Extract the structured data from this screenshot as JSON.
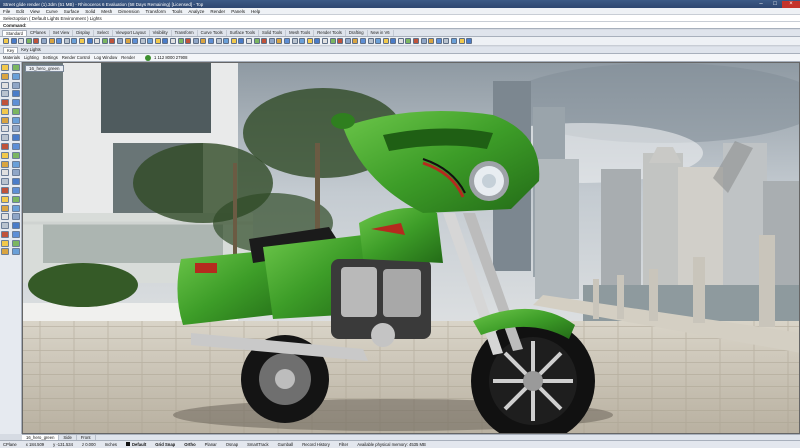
{
  "window": {
    "title": "Street glide render (1).3dm (51 MB) - Rhinoceros 6 Evaluation (58 Days Remaining) [Licensed] - Top"
  },
  "menu": [
    "File",
    "Edit",
    "View",
    "Curve",
    "Surface",
    "Solid",
    "Mesh",
    "Dimension",
    "Transform",
    "Tools",
    "Analyze",
    "Render",
    "Panels",
    "Help"
  ],
  "history_line": "Selectoption ( Default Lights Environment ) Lights",
  "command_prompt": "Command:",
  "toolbar_tabs": [
    "Standard",
    "CPlanes",
    "Set View",
    "Display",
    "Select",
    "Viewport Layout",
    "Visibility",
    "Transform",
    "Curve Tools",
    "Surface Tools",
    "Solid Tools",
    "Mesh Tools",
    "Render Tools",
    "Drafting",
    "New in V6"
  ],
  "panel_tabs": [
    "Key",
    "Key Lights"
  ],
  "render_toolbar": {
    "items": [
      "Materials",
      "Lighting",
      "Settings",
      "Render Control",
      "Log Window",
      "Render"
    ],
    "memory": "1 112 8000 27908"
  },
  "viewport": {
    "label": "16_hero_green"
  },
  "viewport_tabs": [
    "16_hero_green",
    "Side",
    "Front"
  ],
  "status": {
    "cplane": "CPlane",
    "x": "x 184.509",
    "y": "y -131.534",
    "z": "z 0.000",
    "units": "Inches",
    "layer": "Default",
    "toggles": [
      "Grid Snap",
      "Ortho",
      "Planar",
      "Osnap",
      "SmartTrack",
      "Gumball",
      "Record History",
      "Filter"
    ],
    "memory_text": "Available physical memory: 4535 MB"
  },
  "colors": {
    "bike_green": "#3fa12c",
    "sky": "#b9c2c9",
    "pavement": "#c9c2b3",
    "title_bar": "#2d4670"
  }
}
